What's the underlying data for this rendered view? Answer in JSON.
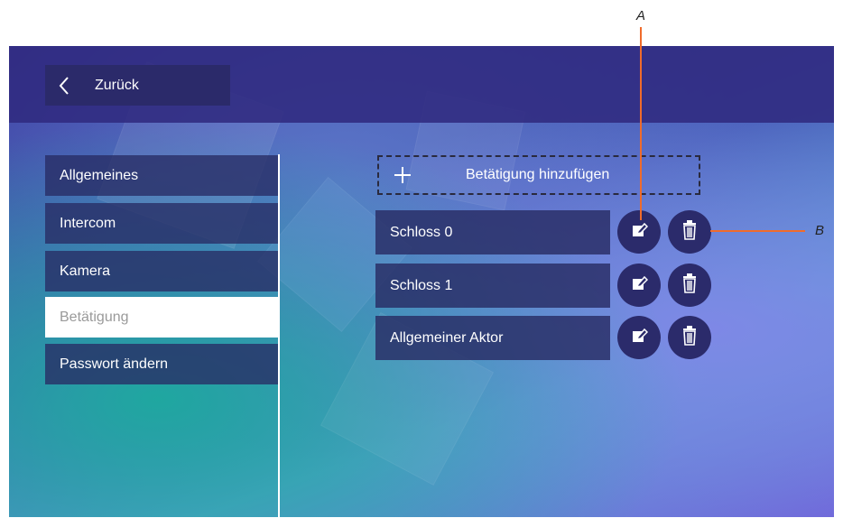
{
  "header": {
    "back_label": "Zurück"
  },
  "sidebar": {
    "items": [
      {
        "label": "Allgemeines",
        "active": false
      },
      {
        "label": "Intercom",
        "active": false
      },
      {
        "label": "Kamera",
        "active": false
      },
      {
        "label": "Betätigung",
        "active": true
      },
      {
        "label": "Passwort ändern",
        "active": false
      }
    ]
  },
  "main": {
    "add_button_label": "Betätigung hinzufügen",
    "rows": [
      {
        "label": "Schloss 0"
      },
      {
        "label": "Schloss 1"
      },
      {
        "label": "Allgemeiner Aktor"
      }
    ]
  },
  "callouts": {
    "a": "A",
    "b": "B"
  },
  "icons": [
    "chevron-left-icon",
    "plus-icon",
    "edit-icon",
    "trash-icon"
  ],
  "colors": {
    "callout": "#f06b2b",
    "button": "#2b2b6b",
    "active_item_bg": "#ffffff"
  }
}
